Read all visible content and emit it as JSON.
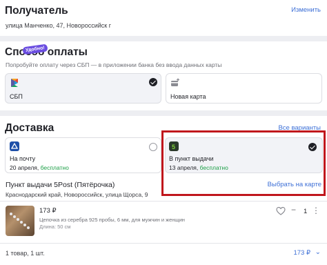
{
  "recipient": {
    "title": "Получатель",
    "change_link": "Изменить",
    "address": "улица Манченко, 47, Новороссийск г"
  },
  "payment": {
    "title": "Способ оплаты",
    "hint": "Попробуйте оплату через СБП — в приложении банка без ввода данных карты",
    "options": [
      {
        "label": "СБП",
        "badge": "Удобно!",
        "selected": true,
        "icon": "sbp-icon"
      },
      {
        "label": "Новая карта",
        "selected": false,
        "icon": "new-card-icon"
      }
    ]
  },
  "delivery": {
    "title": "Доставка",
    "all_variants_link": "Все варианты",
    "options": [
      {
        "label": "На почту",
        "date": "20 апреля",
        "price": "бесплатно",
        "selected": false,
        "icon": "russian-post-icon"
      },
      {
        "label": "В пункт выдачи",
        "date": "13 апреля",
        "price": "бесплатно",
        "selected": true,
        "icon": "5post-icon",
        "map_link": "Выбрать на карте"
      }
    ],
    "pickup_point": {
      "name": "Пункт выдачи 5Post (Пятёрочка)",
      "address": "Краснодарский край, Новороссийск, улица Щорса, 9"
    },
    "item": {
      "price": "173 ₽",
      "name": "Цепочка из серебра 925 пробы, 6 мм, для мужчин и женщин",
      "length": "Длина: 50 см",
      "quantity": "1",
      "minus": "−",
      "plus": "+"
    },
    "summary": {
      "count_label": "1 товар, 1 шт.",
      "total": "173 ₽"
    }
  },
  "colors": {
    "accent": "#3d6fd6",
    "free": "#1a9e45",
    "highlight": "#c0161c",
    "badge": "#6a4de0"
  }
}
